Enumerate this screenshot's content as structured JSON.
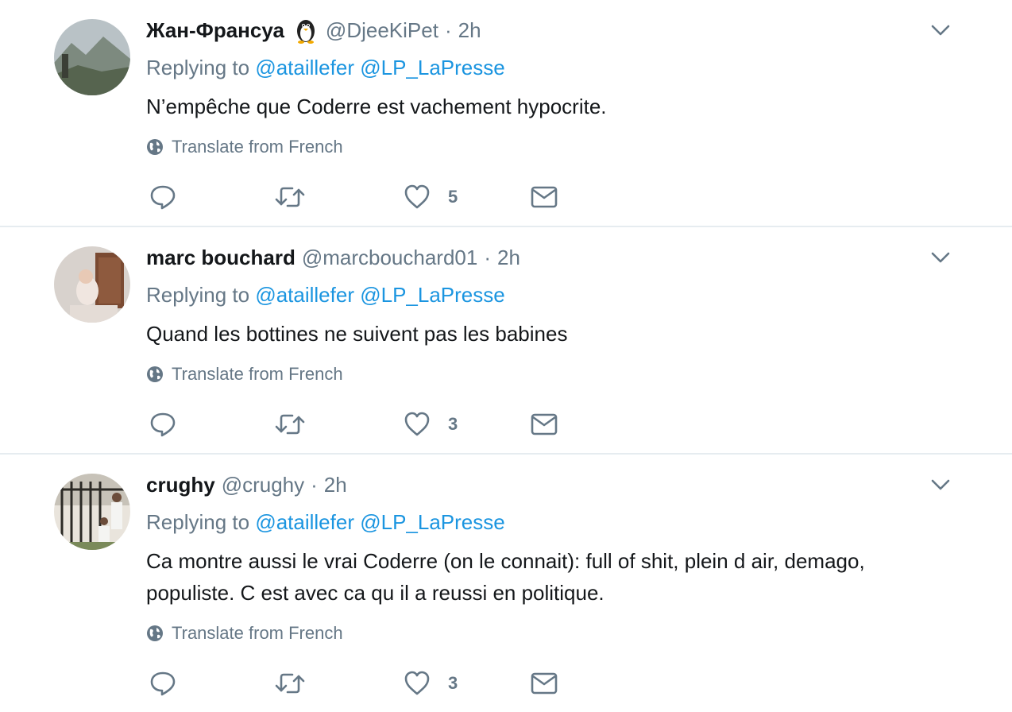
{
  "colors": {
    "link": "#1b95e0",
    "secondary": "#657786",
    "text": "#14171a",
    "divider": "#e6ecf0"
  },
  "tweets": [
    {
      "name": "Жан-Франсуа",
      "emoji": "penguin-emoji",
      "handle": "@DjeeKiPet",
      "separator": "·",
      "time": "2h",
      "replying_prefix": "Replying to",
      "mentions": [
        "@ataillefer",
        "@LP_LaPresse"
      ],
      "lines": [
        "N’empêche que Coderre est vachement hypocrite."
      ],
      "translate_label": "Translate from French",
      "like_count": "5",
      "icons": [
        "reply-icon",
        "retweet-icon",
        "heart-icon",
        "envelope-icon",
        "chevron-down-icon",
        "globe-icon"
      ]
    },
    {
      "name": "marc bouchard",
      "handle": "@marcbouchard01",
      "separator": "·",
      "time": "2h",
      "replying_prefix": "Replying to",
      "mentions": [
        "@ataillefer",
        "@LP_LaPresse"
      ],
      "lines": [
        "Quand les bottines ne suivent pas les babines"
      ],
      "translate_label": "Translate from French",
      "like_count": "3"
    },
    {
      "name": "crughy",
      "handle": "@crughy",
      "separator": "·",
      "time": "2h",
      "replying_prefix": "Replying to",
      "mentions": [
        "@ataillefer",
        "@LP_LaPresse"
      ],
      "lines": [
        "Ca montre aussi le vrai Coderre (on le connait): full of shit, plein d air, demago,",
        "populiste. C est avec ca qu il a reussi en politique."
      ],
      "translate_label": "Translate from French",
      "like_count": "3"
    }
  ]
}
